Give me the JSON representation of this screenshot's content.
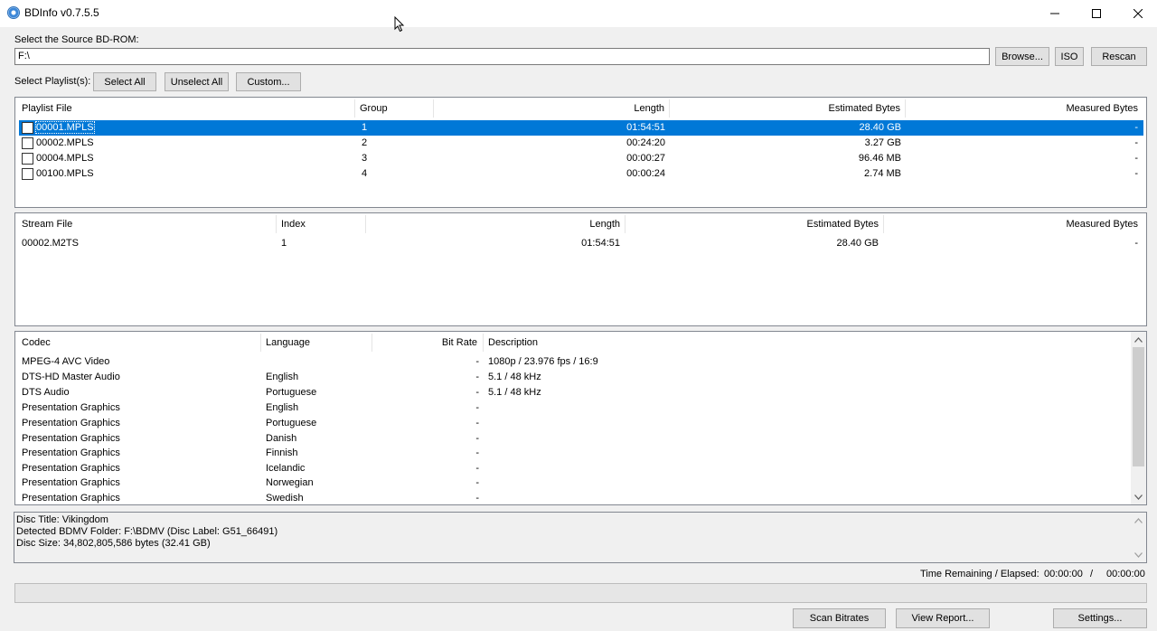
{
  "window": {
    "title": "BDInfo v0.7.5.5"
  },
  "source": {
    "label": "Select the Source BD-ROM:",
    "value": "F:\\"
  },
  "buttons": {
    "browse": "Browse...",
    "iso": "ISO",
    "rescan": "Rescan",
    "select_all": "Select All",
    "unselect_all": "Unselect All",
    "custom": "Custom...",
    "scan_bitrates": "Scan Bitrates",
    "view_report": "View Report...",
    "settings": "Settings..."
  },
  "playlist_label": "Select Playlist(s):",
  "playlists": {
    "headers": [
      "Playlist File",
      "Group",
      "Length",
      "Estimated Bytes",
      "Measured Bytes"
    ],
    "rows": [
      {
        "file": "00001.MPLS",
        "group": "1",
        "length": "01:54:51",
        "est": "28.40 GB",
        "meas": "-",
        "selected": true
      },
      {
        "file": "00002.MPLS",
        "group": "2",
        "length": "00:24:20",
        "est": "3.27 GB",
        "meas": "-"
      },
      {
        "file": "00004.MPLS",
        "group": "3",
        "length": "00:00:27",
        "est": "96.46 MB",
        "meas": "-"
      },
      {
        "file": "00100.MPLS",
        "group": "4",
        "length": "00:00:24",
        "est": "2.74 MB",
        "meas": "-"
      }
    ]
  },
  "streams": {
    "headers": [
      "Stream File",
      "Index",
      "Length",
      "Estimated Bytes",
      "Measured Bytes"
    ],
    "rows": [
      {
        "file": "00002.M2TS",
        "index": "1",
        "length": "01:54:51",
        "est": "28.40 GB",
        "meas": "-"
      }
    ]
  },
  "codecs": {
    "headers": [
      "Codec",
      "Language",
      "Bit Rate",
      "Description"
    ],
    "rows": [
      {
        "codec": "MPEG-4 AVC Video",
        "lang": "",
        "bitrate": "-",
        "desc": "1080p / 23.976 fps / 16:9"
      },
      {
        "codec": "DTS-HD Master Audio",
        "lang": "English",
        "bitrate": "-",
        "desc": "5.1 / 48 kHz"
      },
      {
        "codec": "DTS Audio",
        "lang": "Portuguese",
        "bitrate": "-",
        "desc": "5.1 / 48 kHz"
      },
      {
        "codec": "Presentation Graphics",
        "lang": "English",
        "bitrate": "-",
        "desc": ""
      },
      {
        "codec": "Presentation Graphics",
        "lang": "Portuguese",
        "bitrate": "-",
        "desc": ""
      },
      {
        "codec": "Presentation Graphics",
        "lang": "Danish",
        "bitrate": "-",
        "desc": ""
      },
      {
        "codec": "Presentation Graphics",
        "lang": "Finnish",
        "bitrate": "-",
        "desc": ""
      },
      {
        "codec": "Presentation Graphics",
        "lang": "Icelandic",
        "bitrate": "-",
        "desc": ""
      },
      {
        "codec": "Presentation Graphics",
        "lang": "Norwegian",
        "bitrate": "-",
        "desc": ""
      },
      {
        "codec": "Presentation Graphics",
        "lang": "Swedish",
        "bitrate": "-",
        "desc": ""
      }
    ]
  },
  "disc_info": {
    "line1": "Disc Title: Vikingdom",
    "line2": "Detected BDMV Folder: F:\\BDMV (Disc Label: G51_66491)",
    "line3": "Disc Size: 34,802,805,586 bytes (32.41 GB)"
  },
  "time": {
    "label": "Time Remaining / Elapsed:",
    "remaining": "00:00:00",
    "sep": "/",
    "elapsed": "00:00:00"
  },
  "progress": 0
}
